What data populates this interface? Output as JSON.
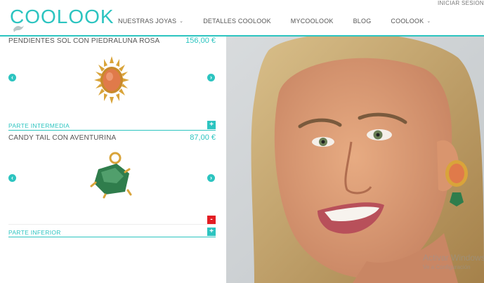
{
  "header": {
    "logo": "COOLOOK",
    "signin": "INICIAR SESION",
    "nav": [
      {
        "label": "NUESTRAS JOYAS",
        "dropdown": true
      },
      {
        "label": "DETALLES COOLOOK",
        "dropdown": false
      },
      {
        "label": "MYCOOLOOK",
        "dropdown": false
      },
      {
        "label": "BLOG",
        "dropdown": false
      },
      {
        "label": "COOLOOK",
        "dropdown": true
      }
    ]
  },
  "products": [
    {
      "title": "PENDIENTES SOL CON PIEDRALUNA ROSA",
      "price": "156,00 €"
    },
    {
      "title": "CANDY TAIL CON AVENTURINA",
      "price": "87,00 €"
    }
  ],
  "sections": [
    {
      "label": "PARTE INTERMEDIA",
      "button": "+"
    },
    {
      "label": "PARTE INFERIOR",
      "button": "+"
    }
  ],
  "remove_button": "-",
  "watermark": {
    "line1": "Activar Windows",
    "line2": "Ve a Configuración"
  },
  "colors": {
    "accent": "#2cc4c0",
    "remove": "#e31d23"
  }
}
